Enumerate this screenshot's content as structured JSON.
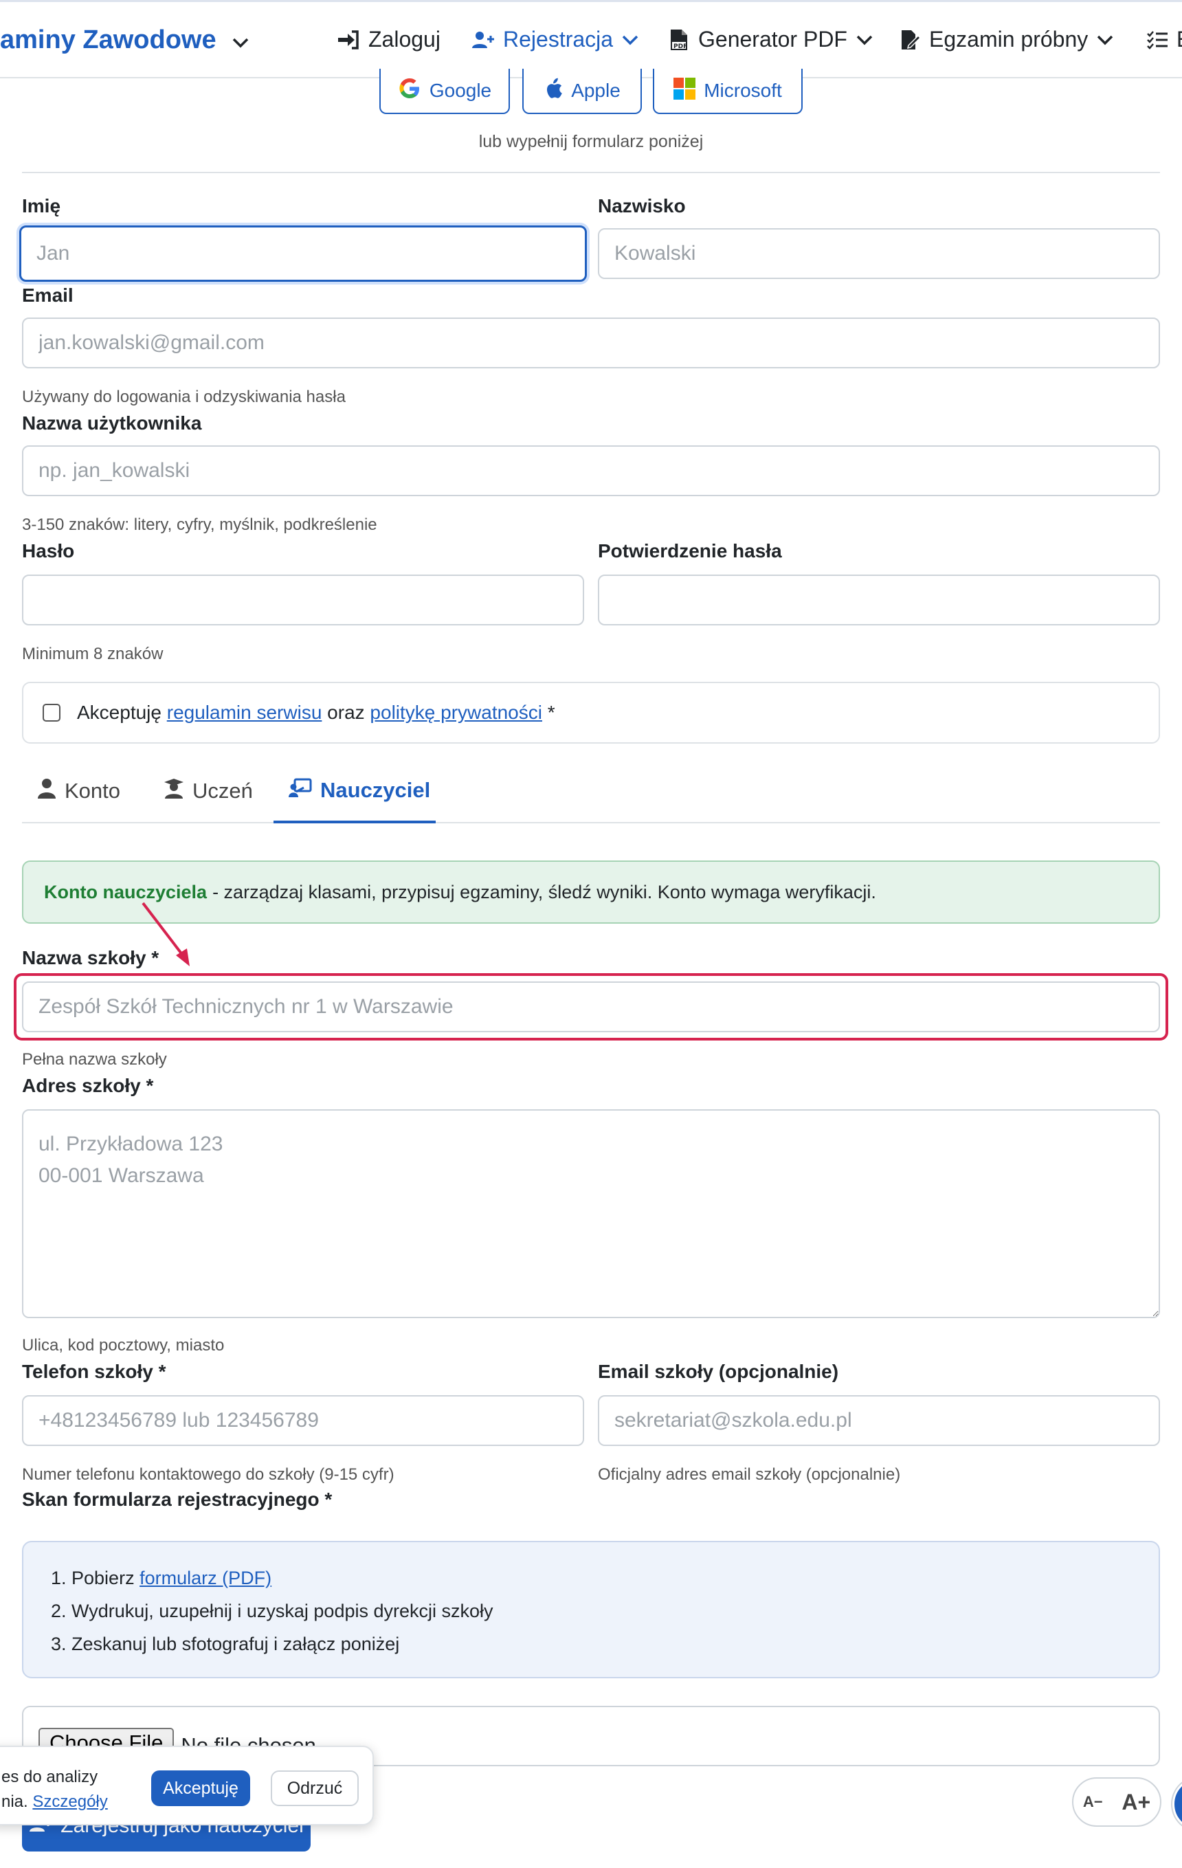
{
  "navbar": {
    "brand": "aminy Zawodowe",
    "items": [
      {
        "label": "Zaloguj"
      },
      {
        "label": "Rejestracja"
      },
      {
        "label": "Generator PDF"
      },
      {
        "label": "Egzamin próbny"
      },
      {
        "label": "E"
      }
    ]
  },
  "social": {
    "google": "Google",
    "apple": "Apple",
    "microsoft": "Microsoft",
    "note": "lub wypełnij formularz poniżej"
  },
  "form": {
    "first_name": {
      "label": "Imię",
      "placeholder": "Jan"
    },
    "last_name": {
      "label": "Nazwisko",
      "placeholder": "Kowalski"
    },
    "email": {
      "label": "Email",
      "placeholder": "jan.kowalski@gmail.com",
      "help": "Używany do logowania i odzyskiwania hasła"
    },
    "username": {
      "label": "Nazwa użytkownika",
      "placeholder": "np. jan_kowalski",
      "help": "3-150 znaków: litery, cyfry, myślnik, podkreślenie"
    },
    "password": {
      "label": "Hasło",
      "help": "Minimum 8 znaków"
    },
    "password_confirm": {
      "label": "Potwierdzenie hasła"
    },
    "terms": {
      "prefix": "Akceptuję",
      "link1": "regulamin serwisu",
      "middle": "oraz",
      "link2": "politykę prywatności",
      "suffix": "*"
    }
  },
  "tabs": [
    {
      "label": "Konto"
    },
    {
      "label": "Uczeń"
    },
    {
      "label": "Nauczyciel"
    }
  ],
  "alert": {
    "title": "Konto nauczyciela",
    "text": "- zarządzaj klasami, przypisuj egzaminy, śledź wyniki. Konto wymaga weryfikacji."
  },
  "teacher": {
    "school_name": {
      "label": "Nazwa szkoły *",
      "placeholder": "Zespół Szkół Technicznych nr 1 w Warszawie",
      "help": "Pełna nazwa szkoły"
    },
    "school_address": {
      "label": "Adres szkoły *",
      "placeholder": "ul. Przykładowa 123\n00-001 Warszawa",
      "help": "Ulica, kod pocztowy, miasto"
    },
    "school_phone": {
      "label": "Telefon szkoły *",
      "placeholder": "+48123456789 lub 123456789",
      "help": "Numer telefonu kontaktowego do szkoły (9-15 cyfr)"
    },
    "school_email": {
      "label": "Email szkoły (opcjonalnie)",
      "placeholder": "sekretariat@szkola.edu.pl",
      "help": "Oficjalny adres email szkoły (opcjonalnie)"
    },
    "scan": {
      "label": "Skan formularza rejestracyjnego *",
      "step1_prefix": "1. Pobierz",
      "step1_link": "formularz (PDF)",
      "step2": "2. Wydrukuj, uzupełnij i uzyskaj podpis dyrekcji szkoły",
      "step3": "3. Zeskanuj lub sfotografuj i załącz poniżej",
      "choose_file": "Choose File",
      "no_file": "No file chosen"
    },
    "submit": "Zarejestruj jako nauczyciel"
  },
  "cookie": {
    "line1": "es do analizy",
    "line2_prefix": "nia.",
    "details_link": "Szczegóły",
    "accept": "Akceptuję",
    "reject": "Odrzuć"
  },
  "font_controls": {
    "decrease": "A−",
    "increase": "A+"
  },
  "colors": {
    "primary": "#1f5fbf",
    "success": "#1e7e34",
    "highlight": "#d6234f"
  }
}
